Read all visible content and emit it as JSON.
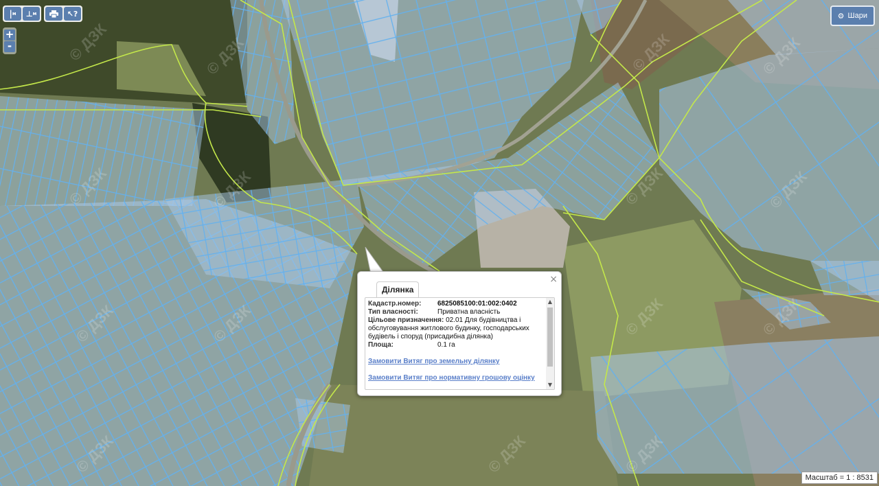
{
  "toolbar": {
    "measure_length_label": "м",
    "measure_area_label": "м",
    "print_icon": "print-icon",
    "identify_icon": "cursor-question-icon"
  },
  "zoom": {
    "in_label": "+",
    "out_label": "-"
  },
  "layers_button": {
    "label": "Шари",
    "icon": "gear-icon"
  },
  "watermark": "© ДЗК",
  "popup": {
    "tab_label": "Ділянка",
    "close_label": "×",
    "fields": [
      {
        "label": "Кадастр.номер:",
        "value": "6825085100:01:002:0402"
      },
      {
        "label": "Тип власності:",
        "value": "Приватна власність"
      },
      {
        "label": "Цільове призначення:",
        "value": "02.01 Для будівництва і обслуговування житлового будинку, господарських будівель і споруд (присадибна ділянка)"
      },
      {
        "label": "Площа:",
        "value": "0.1 га"
      }
    ],
    "links": [
      "Замовити Витяг про земельну ділянку",
      "Замовити Витяг про нормативну грошову оцінку"
    ]
  },
  "scale": {
    "text": "Масштаб = 1 : 8531"
  },
  "colors": {
    "parcel_fill": "#a9c7e6",
    "parcel_stroke": "#63b1ee",
    "boundary_line": "#c4e84a",
    "button": "#5b7fae",
    "link": "#5a7fc9"
  }
}
